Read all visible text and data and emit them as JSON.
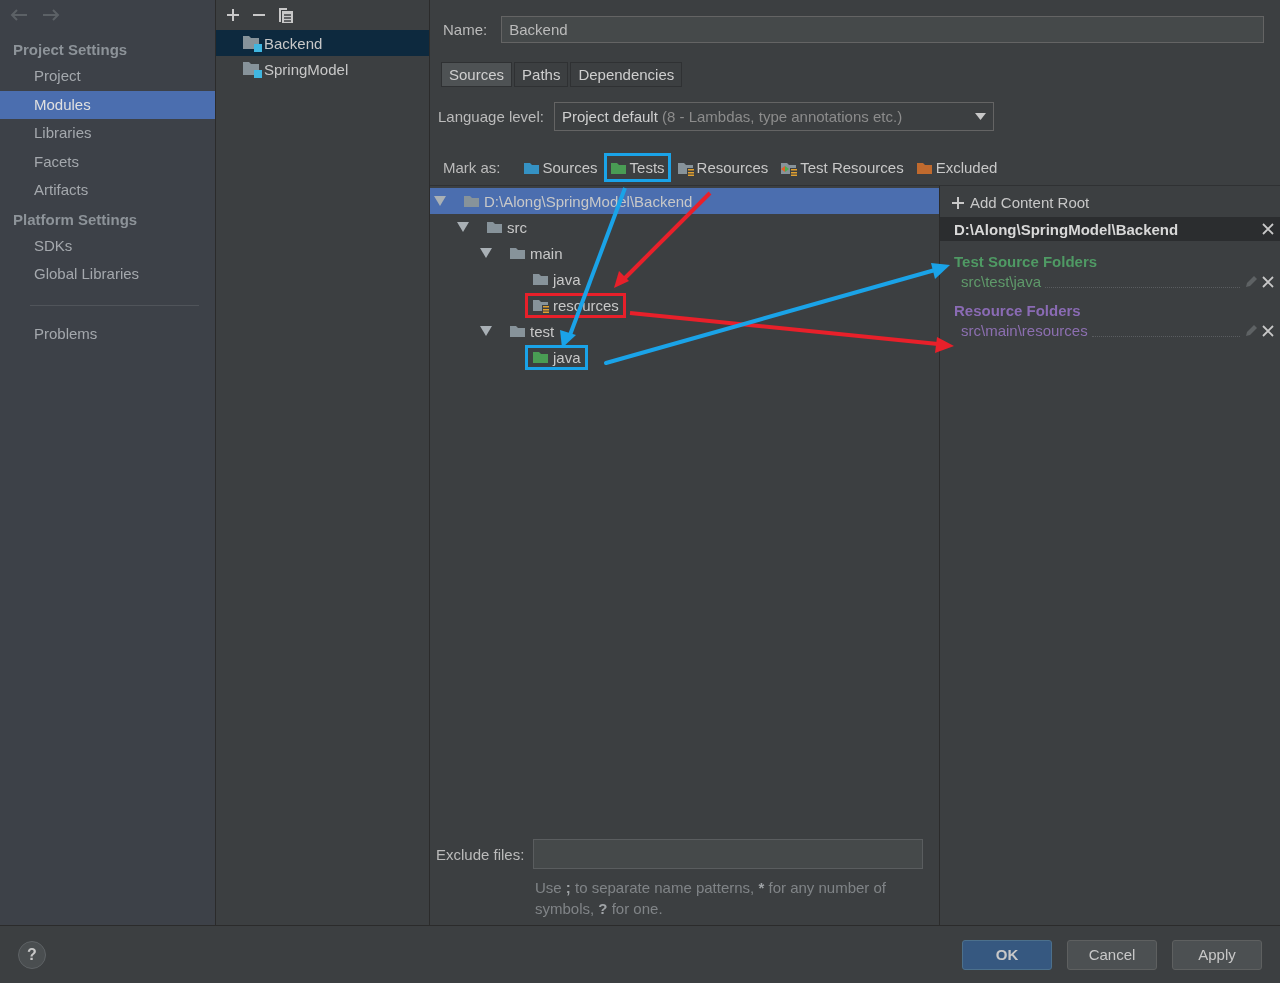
{
  "sidebar": {
    "sections": [
      {
        "title": "Project Settings",
        "items": [
          {
            "label": "Project",
            "selected": false
          },
          {
            "label": "Modules",
            "selected": true
          },
          {
            "label": "Libraries",
            "selected": false
          },
          {
            "label": "Facets",
            "selected": false
          },
          {
            "label": "Artifacts",
            "selected": false
          }
        ]
      },
      {
        "title": "Platform Settings",
        "items": [
          {
            "label": "SDKs",
            "selected": false
          },
          {
            "label": "Global Libraries",
            "selected": false
          }
        ]
      }
    ],
    "problems": "Problems"
  },
  "modules": [
    {
      "name": "Backend",
      "selected": true
    },
    {
      "name": "SpringModel",
      "selected": false
    }
  ],
  "name_field": {
    "label": "Name:",
    "value": "Backend"
  },
  "tabs": [
    {
      "label": "Sources",
      "selected": true
    },
    {
      "label": "Paths",
      "selected": false
    },
    {
      "label": "Dependencies",
      "selected": false
    }
  ],
  "language_level": {
    "label": "Language level:",
    "value": "Project default",
    "hint": "(8 - Lambdas, type annotations etc.)"
  },
  "mark_as": {
    "label": "Mark as:",
    "options": [
      {
        "label": "Sources",
        "kind": "sources"
      },
      {
        "label": "Tests",
        "kind": "tests",
        "color": "#1aa3e8"
      },
      {
        "label": "Resources",
        "kind": "resources"
      },
      {
        "label": "Test Resources",
        "kind": "test-resources"
      },
      {
        "label": "Excluded",
        "kind": "excluded"
      }
    ]
  },
  "tree": {
    "label": "D:\\Along\\SpringModel\\Backend",
    "kind": "folder",
    "selected": true,
    "expanded": true,
    "children": [
      {
        "label": "src",
        "kind": "folder",
        "selected": false,
        "expanded": true,
        "children": [
          {
            "label": "main",
            "kind": "folder",
            "selected": false,
            "expanded": true,
            "children": [
              {
                "label": "java",
                "kind": "folder",
                "selected": false
              },
              {
                "label": "resources",
                "kind": "resources",
                "selected": false,
                "color": "#e8202a"
              }
            ]
          },
          {
            "label": "test",
            "kind": "folder",
            "selected": false,
            "expanded": true,
            "children": [
              {
                "label": "java",
                "kind": "tests",
                "selected": false,
                "color": "#1aa3e8"
              }
            ]
          }
        ]
      }
    ]
  },
  "content_root": {
    "add_label": "Add Content Root",
    "path": "D:\\Along\\SpringModel\\Backend",
    "groups": [
      {
        "title": "Test Source Folders",
        "kind": "tests",
        "folders": [
          "src\\test\\java"
        ]
      },
      {
        "title": "Resource Folders",
        "kind": "resources",
        "folders": [
          "src\\main\\resources"
        ]
      }
    ]
  },
  "exclude": {
    "label": "Exclude files:",
    "hint": "Use **;** to separate name patterns, ***** for any number of symbols, **?** for one."
  },
  "help": "?",
  "buttons": [
    {
      "label": "OK",
      "kind": "primary"
    },
    {
      "label": "Cancel",
      "kind": "normal"
    },
    {
      "label": "Apply",
      "kind": "normal"
    }
  ]
}
